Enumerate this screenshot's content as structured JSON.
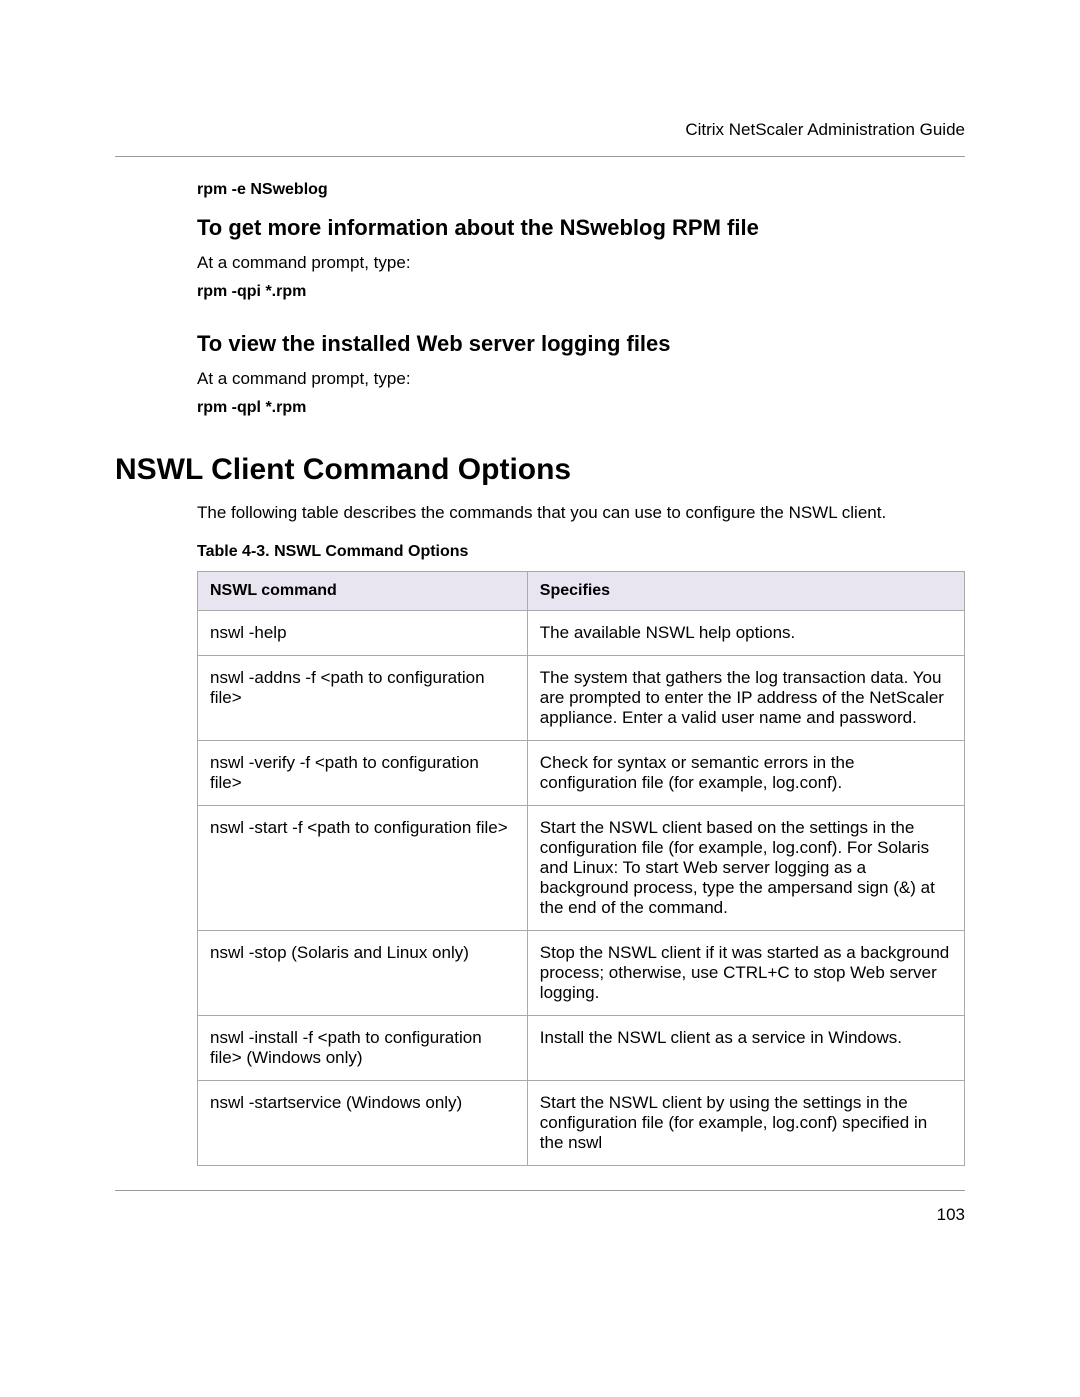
{
  "header": {
    "title": "Citrix NetScaler Administration Guide"
  },
  "section1": {
    "command1": "rpm -e NSweblog",
    "heading1": "To get more information about the NSweblog RPM file",
    "text1": "At a command prompt, type:",
    "command2": "rpm -qpi *.rpm",
    "heading2": "To view the installed Web server logging files",
    "text2": "At a command prompt, type:",
    "command3": "rpm -qpl *.rpm"
  },
  "section2": {
    "mainHeading": "NSWL Client Command Options",
    "intro": "The following table describes the commands that you can use to configure the NSWL client.",
    "tableCaption": "Table 4-3. NSWL Command Options",
    "tableHeaders": {
      "col1": "NSWL command",
      "col2": "Specifies"
    },
    "rows": [
      {
        "cmd": "nswl -help",
        "spec": "The available NSWL help options."
      },
      {
        "cmd": "nswl -addns -f <path to configuration file>",
        "spec": "The system that gathers the log transaction data. You are prompted to enter the IP address of the NetScaler appliance. Enter a valid user name and password."
      },
      {
        "cmd": "nswl -verify -f <path to configuration file>",
        "spec": "Check for syntax or semantic errors in the configuration file (for example, log.conf)."
      },
      {
        "cmd": "nswl -start -f <path to configuration file>",
        "spec": "Start the NSWL client based on the settings in the configuration file (for example, log.conf). For Solaris and Linux: To start Web server logging as a background process, type the ampersand sign (&) at the end of the command."
      },
      {
        "cmd": "nswl -stop (Solaris and Linux only)",
        "spec": "Stop the NSWL client if it was started as a background process; otherwise, use CTRL+C to stop Web server logging."
      },
      {
        "cmd": "nswl -install -f <path to configuration file> (Windows only)",
        "spec": "Install the NSWL client as a service in Windows."
      },
      {
        "cmd": "nswl -startservice (Windows only)",
        "spec": "Start the NSWL client by using the settings in the configuration file (for example, log.conf) specified in the nswl"
      }
    ]
  },
  "footer": {
    "pageNumber": "103"
  }
}
